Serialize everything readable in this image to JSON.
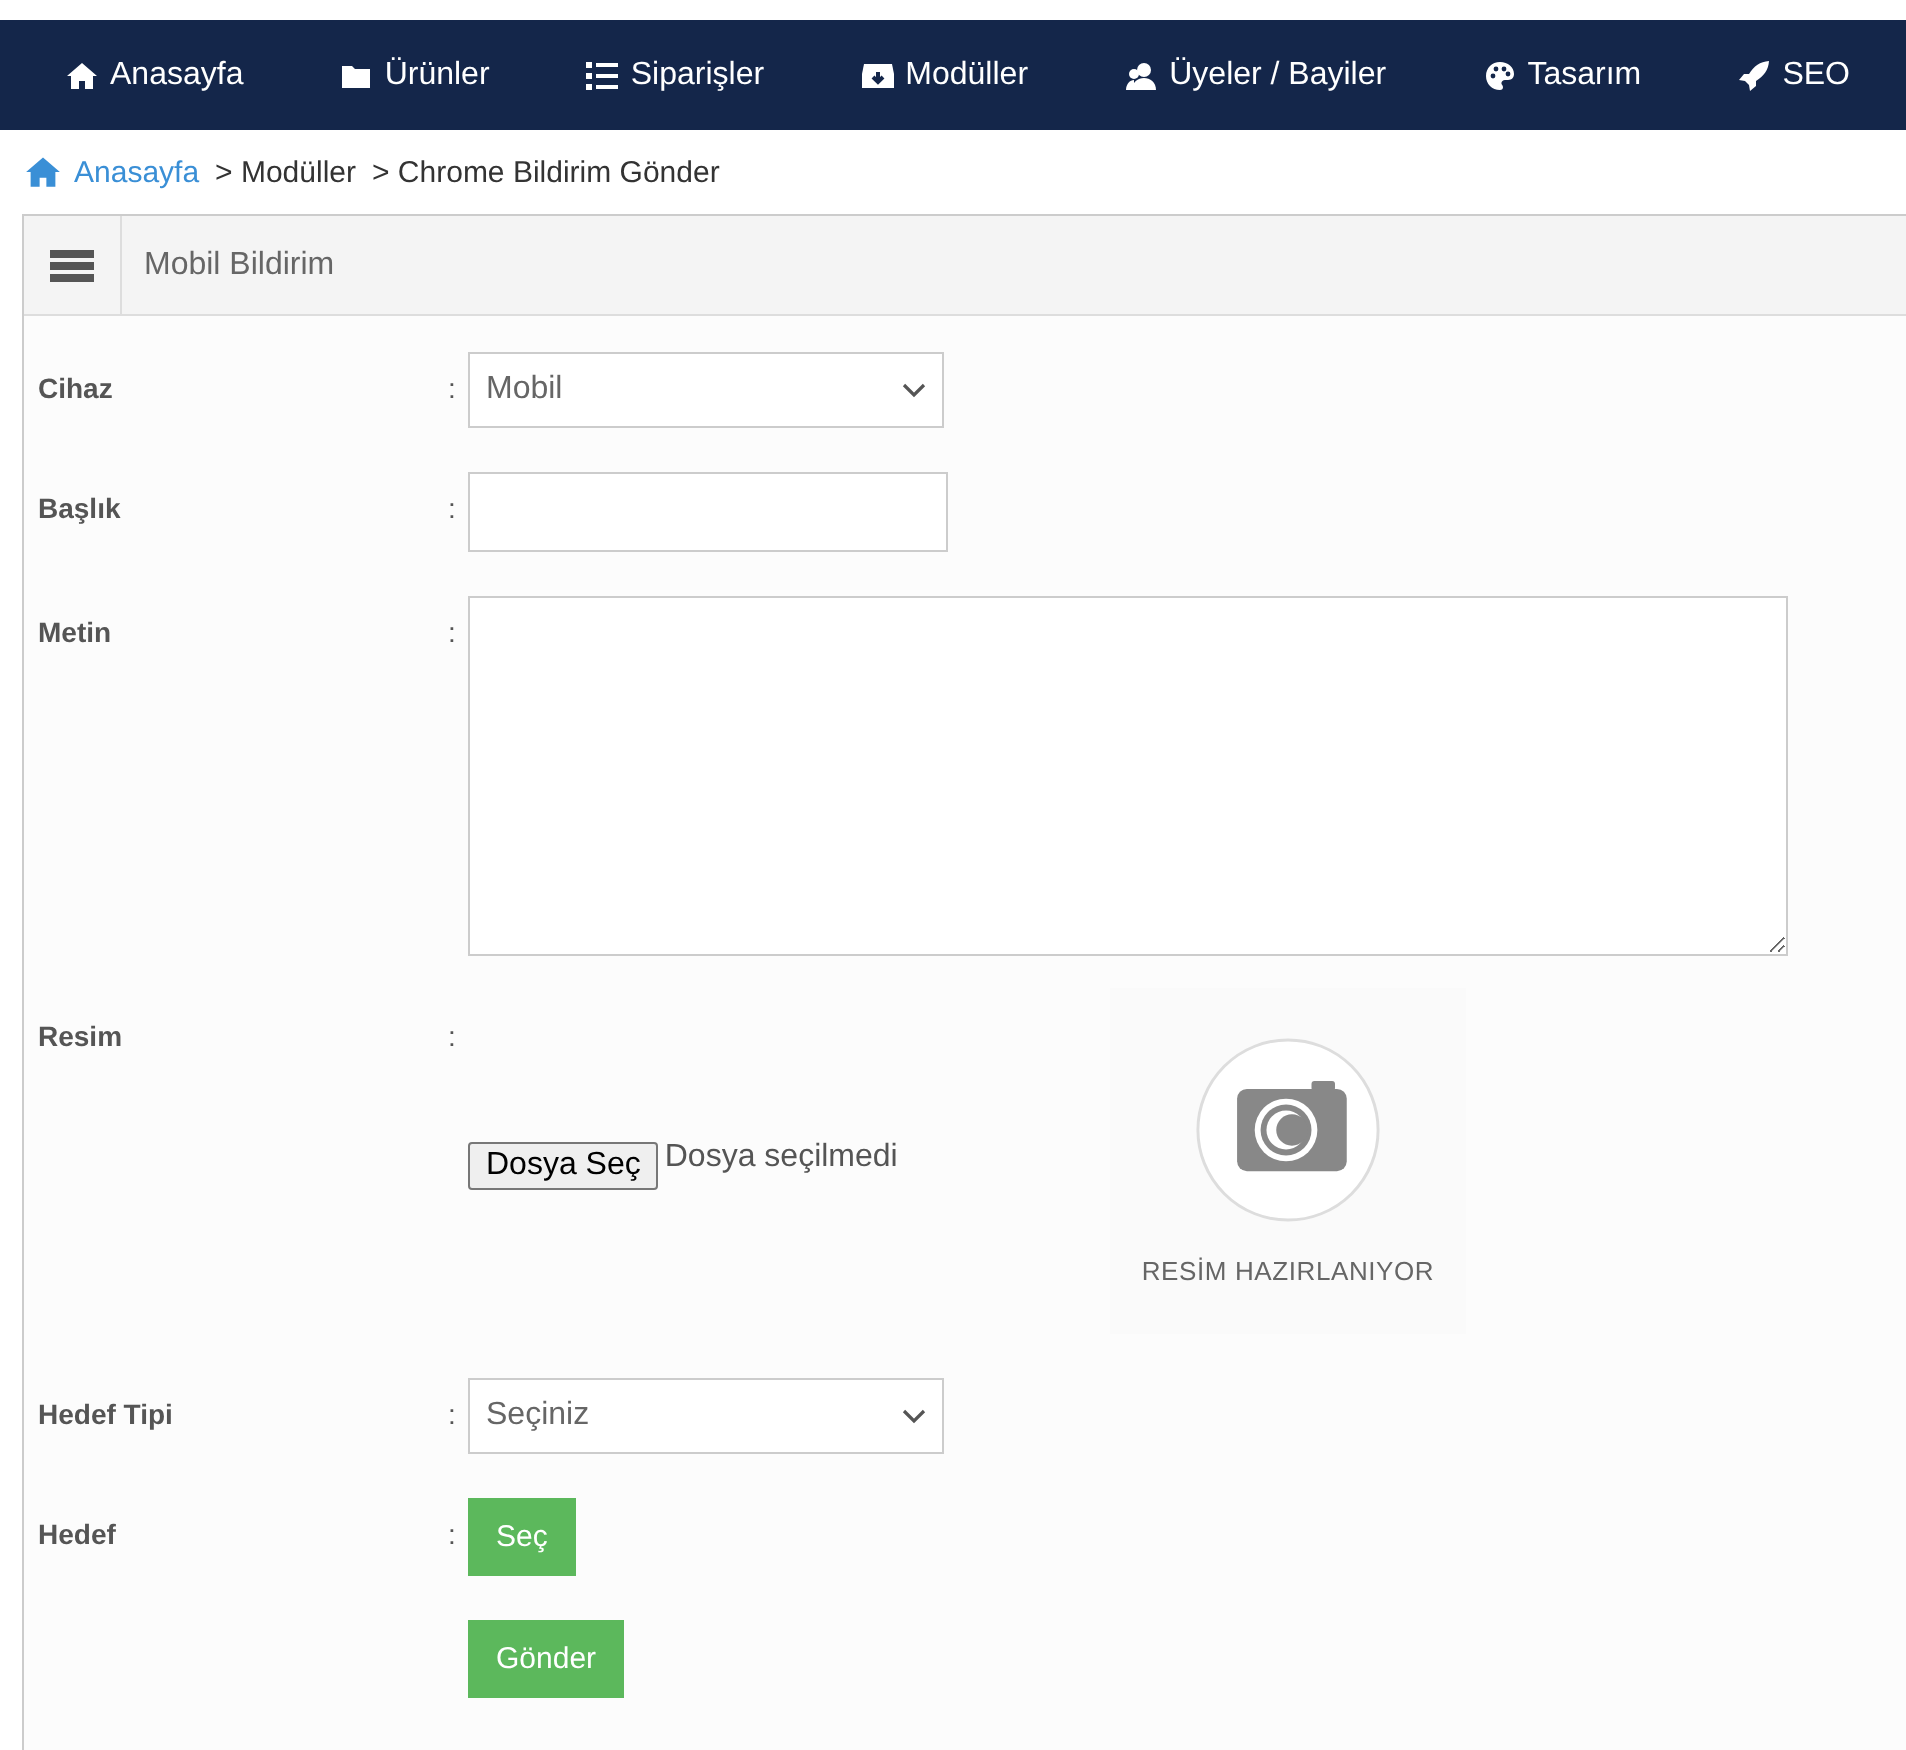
{
  "nav": [
    {
      "label": "Anasayfa"
    },
    {
      "label": "Ürünler"
    },
    {
      "label": "Siparişler"
    },
    {
      "label": "Modüller"
    },
    {
      "label": "Üyeler / Bayiler"
    },
    {
      "label": "Tasarım"
    },
    {
      "label": "SEO"
    }
  ],
  "breadcrumb": [
    {
      "label": "Anasayfa",
      "kind": "link"
    },
    {
      "label": "> Modüller",
      "kind": "text"
    },
    {
      "label": "> Chrome Bildirim Gönder",
      "kind": "text"
    }
  ],
  "panel": {
    "title": "Mobil Bildirim"
  },
  "form": {
    "rows": [
      {
        "label": "Cihaz",
        "separator": ":",
        "kind": "select",
        "value": "Mobil"
      },
      {
        "label": "Başlık",
        "separator": ":",
        "kind": "text"
      },
      {
        "label": "Metin",
        "separator": ":",
        "kind": "textarea"
      },
      {
        "label": "Resim",
        "separator": ":",
        "kind": "file",
        "button": "Dosya Seç",
        "status": "Dosya seçilmedi",
        "preview_caption": "RESİM HAZIRLANIYOR"
      },
      {
        "label": "Hedef Tipi",
        "separator": ":",
        "kind": "select",
        "value": "Seçiniz"
      },
      {
        "label": "Hedef",
        "separator": ":",
        "kind": "button",
        "button": "Seç"
      }
    ],
    "submit": "Gönder"
  }
}
